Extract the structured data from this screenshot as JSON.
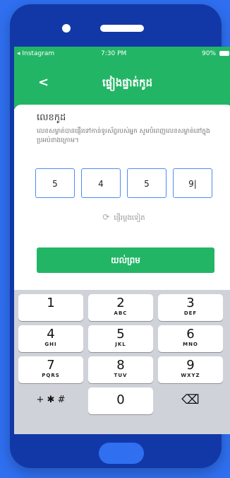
{
  "status_bar": {
    "app": "◂ Instagram",
    "time": "7:30 PM",
    "battery": "90%"
  },
  "header": {
    "back": "<",
    "title": "ផ្ទៀងផ្ទាត់កូដ"
  },
  "card": {
    "title": "លេខកូដ",
    "description": "លេខសម្ងាត់បានផ្ញើរទៅកាន់ទូរស័ព្ទរបស់អ្នក សូមបំពេញលេខសម្ងាត់នៅក្នុងប្រអប់ខាងក្រោម។",
    "code_digits": [
      "5",
      "4",
      "5",
      "9|"
    ],
    "resend": "ផ្ញើរម្តងទៀត",
    "confirm": "យល់ព្រម"
  },
  "keyboard": {
    "keys": [
      {
        "num": "1",
        "sub": ""
      },
      {
        "num": "2",
        "sub": "ABC"
      },
      {
        "num": "3",
        "sub": "DEF"
      },
      {
        "num": "4",
        "sub": "GHI"
      },
      {
        "num": "5",
        "sub": "JKL"
      },
      {
        "num": "6",
        "sub": "MNO"
      },
      {
        "num": "7",
        "sub": "PQRS"
      },
      {
        "num": "8",
        "sub": "TUV"
      },
      {
        "num": "9",
        "sub": "WXYZ"
      },
      {
        "num": "+ ✱ #",
        "sub": ""
      },
      {
        "num": "0",
        "sub": ""
      },
      {
        "num": "⌫",
        "sub": ""
      }
    ]
  },
  "colors": {
    "accent": "#23b566",
    "frame": "#1238a8",
    "background": "#2f6ff0",
    "input_border": "#4e8cf0"
  }
}
